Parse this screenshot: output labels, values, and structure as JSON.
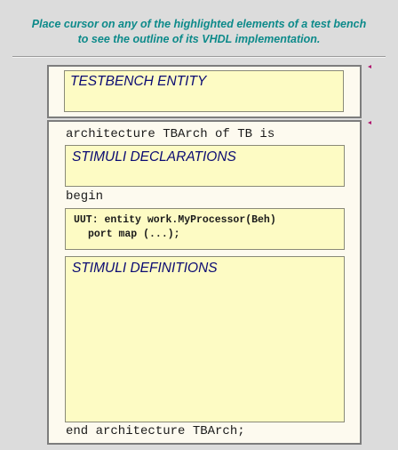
{
  "instructions": {
    "line1": "Place cursor on any of the highlighted elements of a test bench",
    "line2": "to see the outline of its VHDL implementation."
  },
  "entity": {
    "label": "TESTBENCH ENTITY"
  },
  "architecture": {
    "header": "architecture TBArch of TB is",
    "declarations_label": "STIMULI DECLARATIONS",
    "begin": "begin",
    "uut_line1": "UUT: entity work.MyProcessor(Beh)",
    "uut_line2": "port map (...);",
    "definitions_label": "STIMULI DEFINITIONS",
    "end": "end architecture TBArch;"
  },
  "colors": {
    "instruction_text": "#0d8a8a",
    "panel_bg": "#fdfaef",
    "highlight_bg": "#fdfbc4",
    "label_text": "#0b0b73",
    "marker": "#b0156e",
    "page_bg": "#dcdcdc"
  }
}
